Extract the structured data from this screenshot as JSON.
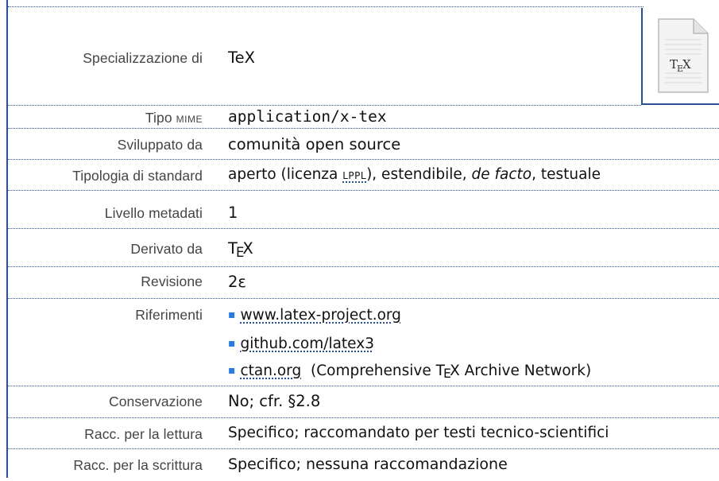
{
  "rows": {
    "spec": {
      "label": "Specializzazione di",
      "value": "TeX"
    },
    "mime": {
      "label_main": "Tipo ",
      "label_sc": "MIME",
      "value": "application/x-tex"
    },
    "dev": {
      "label": "Sviluppato da",
      "value": "comunità open source"
    },
    "type": {
      "label": "Tipologia di standard",
      "v1": "aperto (licenza ",
      "v_sc": "LPPL",
      "v2": "), estendibile, ",
      "v_it": "de facto",
      "v3": ", testuale"
    },
    "meta": {
      "label": "Livello metadati",
      "value": "1"
    },
    "derived": {
      "label": "Derivato da",
      "t": "T",
      "e": "E",
      "x": "X"
    },
    "rev": {
      "label": "Revisione",
      "value": "2ε"
    },
    "refs": {
      "label": "Riferimenti",
      "items": [
        {
          "bullet": "▪",
          "link": "www.latex-project.org"
        },
        {
          "bullet": "▪",
          "link": "github.com/latex3"
        },
        {
          "bullet": "▪",
          "link": "ctan.org",
          "note_pre": "(Comprehensive T",
          "note_e": "E",
          "note_post": "X Archive Network)"
        }
      ]
    },
    "cons": {
      "label": "Conservazione",
      "value": "No;  cfr. §2.8"
    },
    "read": {
      "label": "Racc. per la lettura",
      "value": "Specifico; raccomandato per testi tecnico-scientifici"
    },
    "write": {
      "label": "Racc. per la scrittura",
      "value": "Specifico; nessuna raccomandazione"
    }
  },
  "file_icon": {
    "name": "file-document-icon",
    "glyph_t": "T",
    "glyph_e": "E",
    "glyph_x": "X"
  },
  "colors": {
    "accent": "#2a4f93",
    "bullet": "#2a7be0"
  }
}
